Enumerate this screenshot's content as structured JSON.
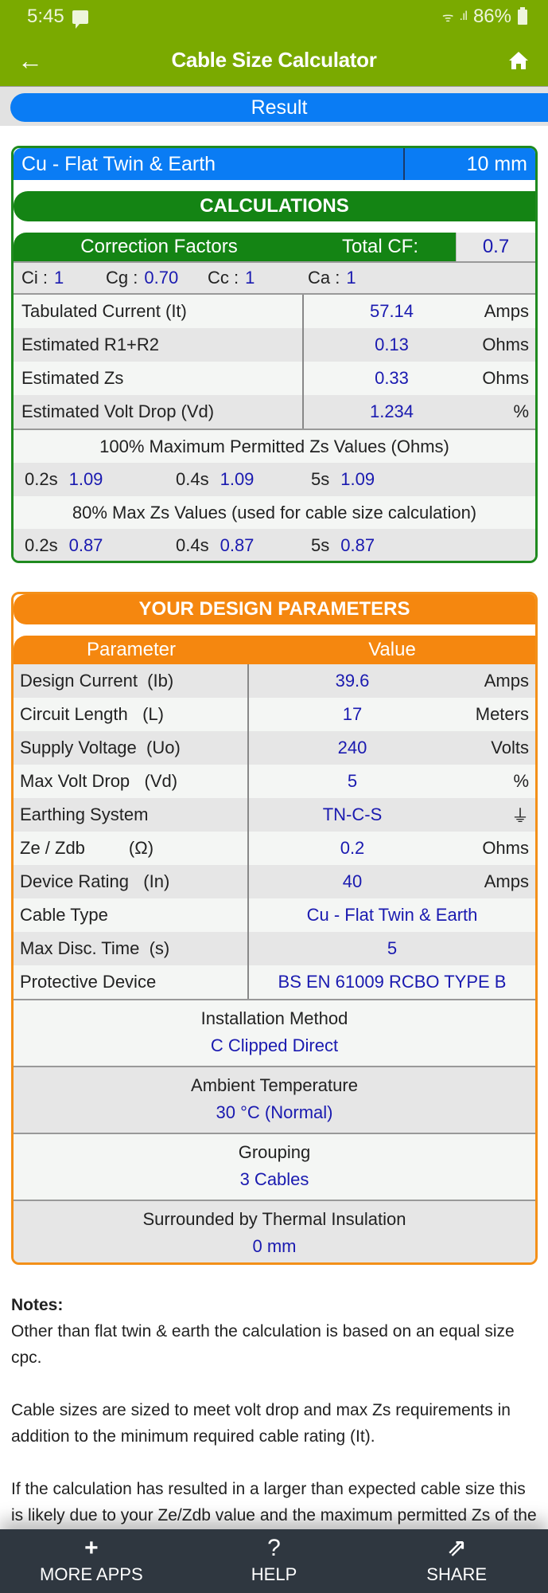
{
  "status_bar": {
    "time": "5:45",
    "battery": "86%"
  },
  "app_bar": {
    "title": "Cable Size Calculator",
    "back_icon": "arrow-left-icon",
    "home_icon": "home-icon"
  },
  "result_tab": {
    "label": "Result"
  },
  "calculations": {
    "cable_type": "Cu - Flat Twin & Earth",
    "cable_size": "10 mm",
    "header": "CALCULATIONS",
    "correction_factors_label": "Correction Factors",
    "total_cf_label": "Total CF:",
    "total_cf_value": "0.7",
    "factors": [
      {
        "label": "Ci :",
        "value": "1"
      },
      {
        "label": "Cg :",
        "value": "0.70"
      },
      {
        "label": "Cc :",
        "value": "1"
      },
      {
        "label": "Ca :",
        "value": "1"
      }
    ],
    "rows": [
      {
        "label": "Tabulated Current  (It)",
        "value": "57.14",
        "unit": "Amps"
      },
      {
        "label": "Estimated R1+R2",
        "value": "0.13",
        "unit": "Ohms"
      },
      {
        "label": "Estimated Zs",
        "value": "0.33",
        "unit": "Ohms"
      },
      {
        "label": "Estimated Volt Drop  (Vd)",
        "value": "1.234",
        "unit": "%"
      }
    ],
    "zs_100_title": "100% Maximum Permitted Zs Values (Ohms)",
    "zs_100": [
      {
        "time": "0.2s",
        "value": "1.09"
      },
      {
        "time": "0.4s",
        "value": "1.09"
      },
      {
        "time": "5s",
        "value": "1.09"
      }
    ],
    "zs_80_title": "80% Max Zs Values (used for cable size calculation)",
    "zs_80": [
      {
        "time": "0.2s",
        "value": "0.87"
      },
      {
        "time": "0.4s",
        "value": "0.87"
      },
      {
        "time": "5s",
        "value": "0.87"
      }
    ]
  },
  "design_parameters": {
    "header": "YOUR DESIGN PARAMETERS",
    "col_parameter": "Parameter",
    "col_value": "Value",
    "rows": [
      {
        "label": "Design Current  (Ib)",
        "value": "39.6",
        "unit": "Amps"
      },
      {
        "label": "Circuit Length   (L)",
        "value": "17",
        "unit": "Meters"
      },
      {
        "label": "Supply Voltage  (Uo)",
        "value": "240",
        "unit": "Volts"
      },
      {
        "label": "Max Volt Drop   (Vd)",
        "value": "5",
        "unit": "%"
      },
      {
        "label": "Earthing System",
        "value": "TN-C-S",
        "unit": "⏚"
      },
      {
        "label": "Ze / Zdb         (Ω)",
        "value": "0.2",
        "unit": "Ohms"
      },
      {
        "label": "Device Rating   (In)",
        "value": "40",
        "unit": "Amps"
      },
      {
        "label": "Cable Type",
        "value": "Cu - Flat Twin & Earth",
        "unit": ""
      },
      {
        "label": "Max Disc. Time  (s)",
        "value": "5",
        "unit": ""
      },
      {
        "label": "Protective Device",
        "value": "BS EN 61009 RCBO TYPE B",
        "unit": ""
      }
    ],
    "blocks": [
      {
        "title": "Installation Method",
        "value": "C Clipped Direct"
      },
      {
        "title": "Ambient Temperature",
        "value": "30 °C (Normal)"
      },
      {
        "title": "Grouping",
        "value": "3 Cables"
      },
      {
        "title": "Surrounded by Thermal Insulation",
        "value": "0 mm"
      }
    ]
  },
  "notes": {
    "heading": "Notes:",
    "paragraphs": [
      "Other than flat twin & earth the calculation is based on an equal size cpc.",
      "Cable sizes are sized to meet volt drop and max Zs requirements in addition to the minimum required cable rating (It).",
      "If the calculation has resulted in a larger than expected cable size this is likely due to your Ze/Zdb value and the maximum permitted Zs of the protective device or due to the length of circuit."
    ]
  },
  "bottom_nav": [
    {
      "label": "MORE APPS",
      "icon": "+"
    },
    {
      "label": "HELP",
      "icon": "?"
    },
    {
      "label": "SHARE",
      "icon": "⇗"
    }
  ],
  "colors": {
    "app_bar": "#7aaa00",
    "accent_blue": "#0a7cf4",
    "calc_green": "#148414",
    "params_orange": "#f5870f",
    "value_blue": "#1a1ab0",
    "nav_bg": "#2f3740"
  }
}
